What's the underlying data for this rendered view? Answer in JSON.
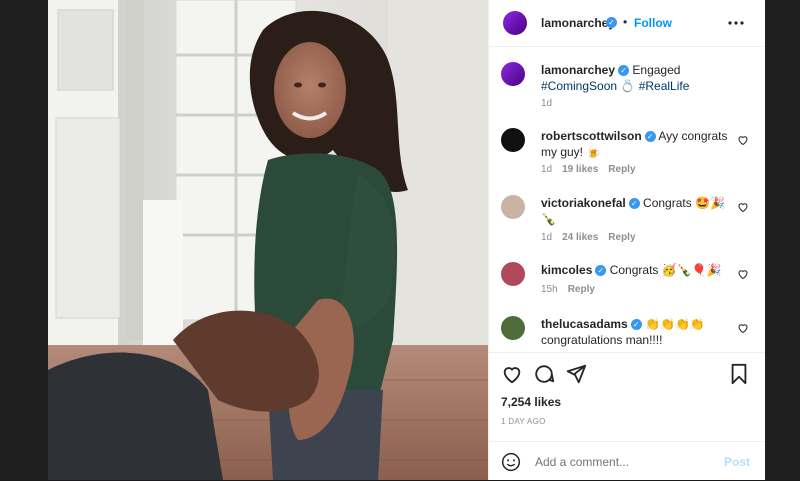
{
  "header": {
    "username": "lamonarchey",
    "separator": "•",
    "follow_label": "Follow",
    "more_icon": "more-horizontal-icon"
  },
  "caption": {
    "username": "lamonarchey",
    "text": "Engaged",
    "hashtag1": "#ComingSoon",
    "hashtag2": "#RealLife",
    "time": "1d"
  },
  "comments": [
    {
      "username": "robertscottwilson",
      "text": "Ayy congrats my guy! 🍺",
      "time": "1d",
      "likes": "19 likes",
      "reply": "Reply"
    },
    {
      "username": "victoriakonefal",
      "text": "Congrats 🤩🎉🍾",
      "time": "1d",
      "likes": "24 likes",
      "reply": "Reply"
    },
    {
      "username": "kimcoles",
      "text": "Congrats 🥳🍾🎈🎉",
      "time": "15h",
      "reply": "Reply"
    },
    {
      "username": "thelucasadams",
      "text": "👏👏👏👏 congratulations man!!!!"
    }
  ],
  "actions": {
    "likes": "7,254 likes",
    "date": "1 DAY AGO"
  },
  "add_comment": {
    "placeholder": "Add a comment...",
    "post_label": "Post"
  },
  "colors": {
    "link": "#0095f6",
    "post_disabled": "#b2dffc",
    "verified": "#3897f0"
  }
}
